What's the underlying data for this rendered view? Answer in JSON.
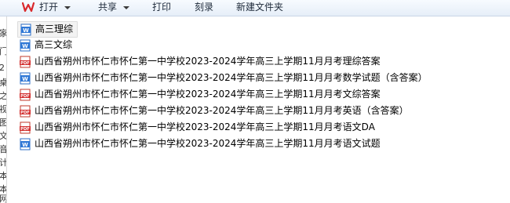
{
  "toolbar": {
    "open_label": "打开",
    "share_label": "共享",
    "print_label": "打印",
    "burn_label": "刻录",
    "new_folder_label": "新建文件夹"
  },
  "left_strip": {
    "fragments": [
      "家",
      "门",
      "2",
      "桌",
      "之",
      "视",
      "图",
      "文",
      "音",
      "计",
      "本",
      "本",
      "本",
      "网"
    ]
  },
  "files": [
    {
      "icon": "word-doc-icon",
      "name": "高三理综"
    },
    {
      "icon": "word-doc-icon",
      "name": "高三文综"
    },
    {
      "icon": "pdf-icon",
      "name": "山西省朔州市怀仁市怀仁第一中学校2023-2024学年高三上学期11月月考理综答案"
    },
    {
      "icon": "word-doc-icon",
      "name": "山西省朔州市怀仁市怀仁第一中学校2023-2024学年高三上学期11月月考数学试题（含答案）"
    },
    {
      "icon": "pdf-icon",
      "name": "山西省朔州市怀仁市怀仁第一中学校2023-2024学年高三上学期11月月考文综答案"
    },
    {
      "icon": "pdf-icon",
      "name": "山西省朔州市怀仁市怀仁第一中学校2023-2024学年高三上学期11月月考英语（含答案）"
    },
    {
      "icon": "pdf-icon",
      "name": "山西省朔州市怀仁市怀仁第一中学校2023-2024学年高三上学期11月月考语文DA"
    },
    {
      "icon": "word-doc-icon",
      "name": "山西省朔州市怀仁市怀仁第一中学校2023-2024学年高三上学期11月月考语文试题"
    }
  ]
}
